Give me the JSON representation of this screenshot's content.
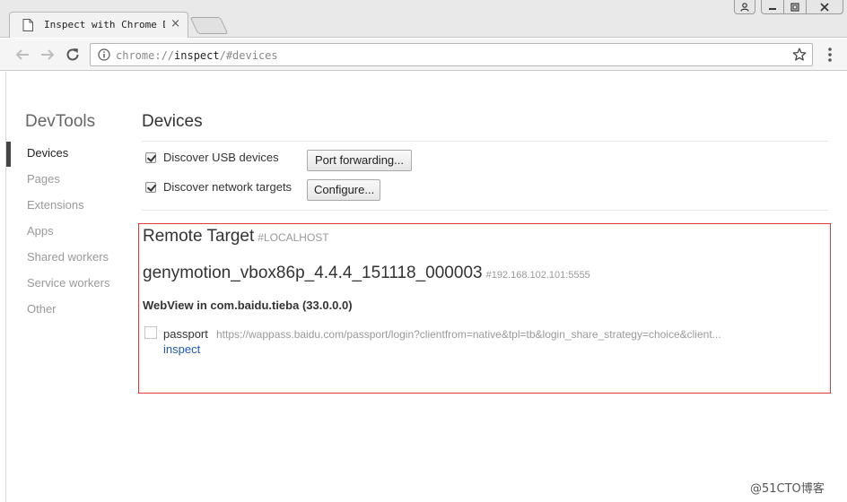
{
  "browser": {
    "tab_title": "Inspect with Chrome Developer Tools",
    "tab_close": "×",
    "window_buttons": {
      "user": "user-icon",
      "minimize": "minimize-icon",
      "maximize": "maximize-icon",
      "close": "close-icon"
    },
    "url_scheme": "chrome://",
    "url_host": "inspect",
    "url_path": "/#devices"
  },
  "sidebar": {
    "title": "DevTools",
    "items": [
      {
        "label": "Devices"
      },
      {
        "label": "Pages"
      },
      {
        "label": "Extensions"
      },
      {
        "label": "Apps"
      },
      {
        "label": "Shared workers"
      },
      {
        "label": "Service workers"
      },
      {
        "label": "Other"
      }
    ]
  },
  "main": {
    "title": "Devices",
    "options": {
      "usb_label": "Discover USB devices",
      "usb_checked": true,
      "port_forwarding_button": "Port forwarding...",
      "network_label": "Discover network targets",
      "network_checked": true,
      "configure_button": "Configure..."
    },
    "remote_target": {
      "title": "Remote Target",
      "subtitle": "#LOCALHOST",
      "device_name": "genymotion_vbox86p_4.4.4_151118_000003",
      "device_serial": "#192.168.102.101:5555",
      "webview": "WebView in com.baidu.tieba (33.0.0.0)",
      "target": {
        "name": "passport",
        "url": "https://wappass.baidu.com/passport/login?clientfrom=native&tpl=tb&login_share_strategy=choice&client...",
        "action": "inspect"
      }
    }
  },
  "watermark": "@51CTO博客",
  "colors": {
    "highlight_border": "#e03a3a",
    "link": "#1f58b5",
    "active_nav_bar": "#444444"
  }
}
